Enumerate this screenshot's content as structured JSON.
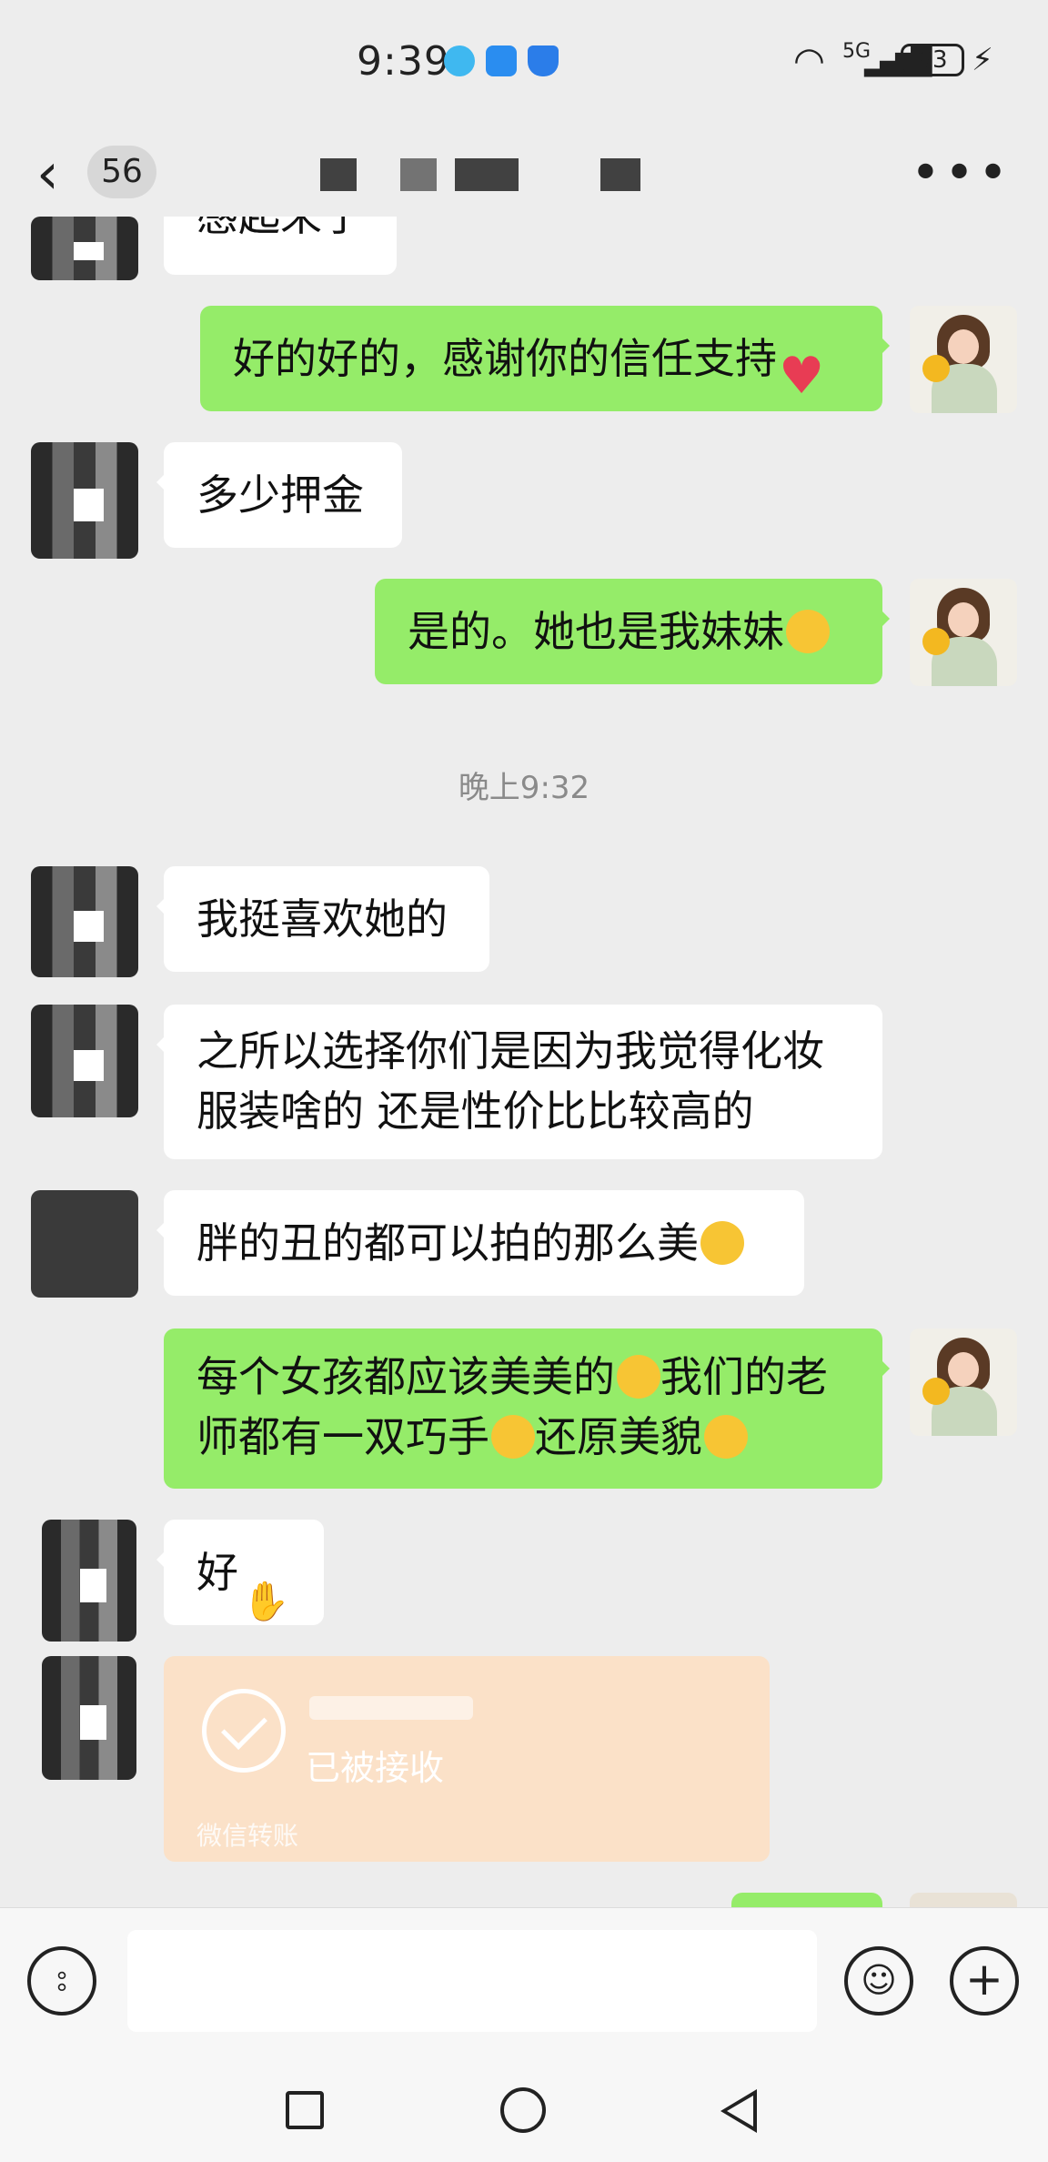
{
  "status_bar": {
    "time": "9:39",
    "network": "5G",
    "battery": "93"
  },
  "nav": {
    "back_icon": "chevron-left-icon",
    "unread_count": "56",
    "more_icon": "more-horizontal-icon"
  },
  "chat": {
    "partial_top_text": "感起来了",
    "timestamp": "晚上9:32",
    "messages": [
      {
        "side": "right",
        "text": "好的好的，感谢你的信任支持",
        "emoji": "heart-emoji"
      },
      {
        "side": "left",
        "text": "多少押金"
      },
      {
        "side": "right",
        "text": "是的。她也是我妹妹",
        "emoji": "grin-emoji"
      },
      {
        "side": "left",
        "text": "我挺喜欢她的"
      },
      {
        "side": "left",
        "line1": "之所以选择你们是因为我觉得化妆",
        "line2": "服装啥的 还是性价比比较高的"
      },
      {
        "side": "left",
        "text": "胖的丑的都可以拍的那么美",
        "emoji": "laugh-cry-emoji"
      },
      {
        "side": "right",
        "line1a": "每个女孩都应该美美的",
        "line1b": "我们的老",
        "line2a": "师都有一双巧手",
        "line2b": "还原美貌",
        "emojis": [
          "grin-emoji",
          "smirk-emoji",
          "hug-emoji"
        ]
      },
      {
        "side": "left",
        "text": "好",
        "emoji": "ok-hand-emoji"
      }
    ],
    "transfer": {
      "status": "已被接收",
      "footer": "微信转账"
    }
  },
  "input_bar": {
    "voice_icon": "voice-icon",
    "emoji_icon": "emoji-icon",
    "plus_icon": "plus-icon"
  },
  "colors": {
    "background": "#ededed",
    "bubble_self": "#95ec69",
    "bubble_other": "#ffffff",
    "transfer": "#fbe1c8"
  }
}
